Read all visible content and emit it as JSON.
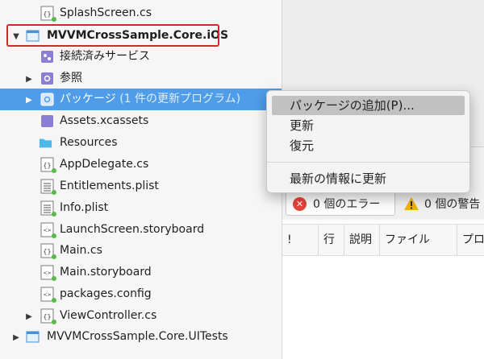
{
  "tree": {
    "items": [
      {
        "label": "SplashScreen.cs",
        "meta": "",
        "icon": "csharp-file-icon"
      },
      {
        "label": "MVVMCrossSample.Core.iOS",
        "meta": "",
        "icon": "project-icon"
      },
      {
        "label": "接続済みサービス",
        "meta": "",
        "icon": "connected-services-icon"
      },
      {
        "label": "参照",
        "meta": "",
        "icon": "references-folder-icon"
      },
      {
        "label": "パッケージ",
        "meta": "(1 件の更新プログラム)",
        "icon": "packages-folder-icon"
      },
      {
        "label": "Assets.xcassets",
        "meta": "",
        "icon": "asset-catalog-icon"
      },
      {
        "label": "Resources",
        "meta": "",
        "icon": "folder-icon"
      },
      {
        "label": "AppDelegate.cs",
        "meta": "",
        "icon": "csharp-file-icon"
      },
      {
        "label": "Entitlements.plist",
        "meta": "",
        "icon": "plist-file-icon"
      },
      {
        "label": "Info.plist",
        "meta": "",
        "icon": "plist-file-icon"
      },
      {
        "label": "LaunchScreen.storyboard",
        "meta": "",
        "icon": "storyboard-file-icon"
      },
      {
        "label": "Main.cs",
        "meta": "",
        "icon": "csharp-file-icon"
      },
      {
        "label": "Main.storyboard",
        "meta": "",
        "icon": "storyboard-file-icon"
      },
      {
        "label": "packages.config",
        "meta": "",
        "icon": "config-file-icon"
      },
      {
        "label": "ViewController.cs",
        "meta": "",
        "icon": "csharp-file-icon"
      },
      {
        "label": "MVVMCrossSample.Core.UITests",
        "meta": "",
        "icon": "project-icon"
      }
    ]
  },
  "context_menu": {
    "items": [
      "パッケージの追加(P)...",
      "更新",
      "復元",
      "最新の情報に更新"
    ]
  },
  "errors_pad": {
    "error_count_label": "0 個のエラー",
    "warning_count_label": "0 個の警告",
    "columns": [
      "!",
      "行",
      "説明",
      "ファイル",
      "プロ"
    ]
  },
  "colors": {
    "selection": "#4f9ce9",
    "highlight_border": "#cf2a2a",
    "error": "#e5453b",
    "warning": "#f0b400"
  }
}
